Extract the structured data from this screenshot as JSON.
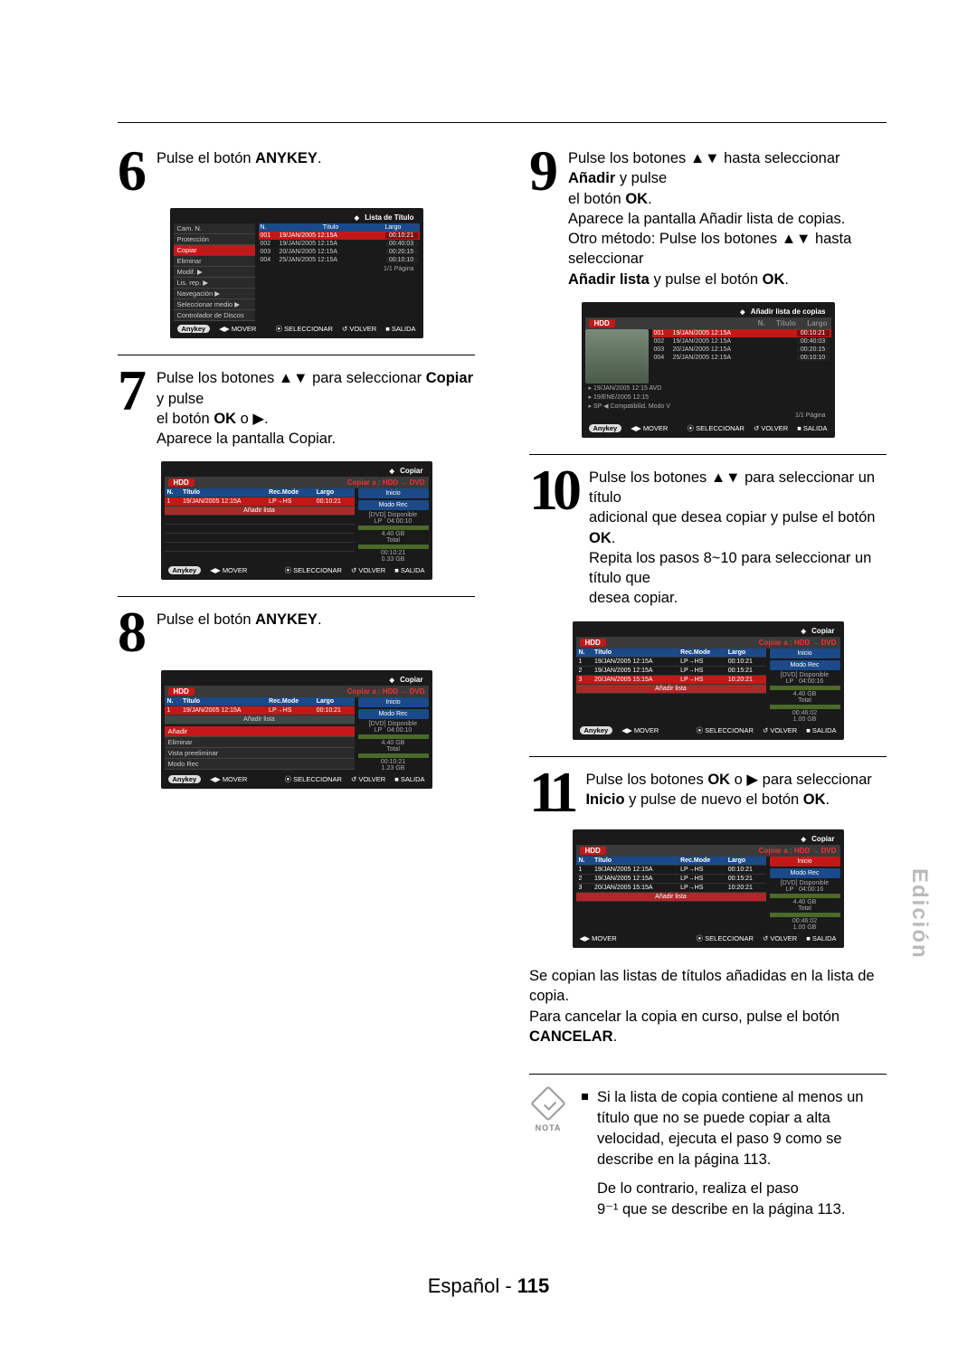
{
  "steps": {
    "s6": {
      "num": "6",
      "html": "Pulse el botón <b>ANYKEY</b>."
    },
    "s7": {
      "num": "7",
      "line1": "Pulse los botones ▲▼ para seleccionar <b>Copiar</b> y pulse",
      "line2": "el botón <b>OK</b> o ▶.",
      "line3": "Aparece la pantalla Copiar."
    },
    "s8": {
      "num": "8",
      "html": "Pulse el botón <b>ANYKEY</b>."
    },
    "s9": {
      "num": "9",
      "line1": "Pulse los botones ▲▼ hasta seleccionar <b>Añadir</b> y pulse",
      "line2": "el botón <b>OK</b>.",
      "line3": "Aparece la pantalla Añadir lista de copias.",
      "line4": "Otro método: Pulse los botones ▲▼ hasta seleccionar",
      "line5": "<b>Añadir lista</b> y pulse el botón <b>OK</b>."
    },
    "s10": {
      "num": "10",
      "line1": "Pulse los botones ▲▼ para seleccionar un título",
      "line2": "adicional que desea copiar y pulse el botón <b>OK</b>.",
      "line3": "Repita los pasos 8~10 para seleccionar un título que",
      "line4": "desea copiar."
    },
    "s11": {
      "num": "11",
      "line1": "Pulse los botones <b>OK</b> o ▶ para seleccionar",
      "line2": "<b>Inicio</b> y pulse de nuevo el botón <b>OK</b>."
    },
    "post11": {
      "line1": "Se copian las listas de títulos añadidas en la lista de copia.",
      "line2": "Para cancelar la copia en curso, pulse el botón",
      "line3": "<b>CANCELAR</b>."
    }
  },
  "note": {
    "label": "NOTA",
    "b1": "Si la lista de copia contiene al menos un título que no se puede copiar a alta velocidad, ejecuta el paso 9 como se describe en la página 113.",
    "b2a": "De lo contrario, realiza el paso",
    "b2b": "9⁻¹ que se describe en la página 113."
  },
  "footer": {
    "lang": "Español",
    "dash": " - ",
    "page": "115"
  },
  "side_tab": "Edición",
  "ui": {
    "anykey": "Anykey",
    "mover": "MOVER",
    "seleccionar": "SELECCIONAR",
    "volver": "VOLVER",
    "salida": "SALIDA",
    "pagina": "1/1 Página",
    "lista_titulo": "Lista de Título",
    "copiar": "Copiar",
    "anadir_lista_copias": "Añadir lista de copias",
    "hdd": "HDD",
    "copiar_a": "Copiar a : HDD → DVD",
    "n": "N.",
    "titulo": "Título",
    "recmode": "Rec.Mode",
    "largo": "Largo",
    "inicio": "Inicio",
    "modo_rec": "Modo Rec",
    "dvd_disp": "[DVD] Disponible",
    "anadir_lista": "Añadir lista",
    "total": "Total"
  },
  "ss6_sidebar": [
    "Cam. N.",
    "Protección",
    "Copiar",
    "Eliminar",
    "Modif.",
    "Lis. rep.",
    "Navegación",
    "Seleccionar medio",
    "Controlador de Discos"
  ],
  "ss6_list": [
    {
      "n": "001",
      "t": "19/JAN/2005 12:15A",
      "l": "00:10:21"
    },
    {
      "n": "002",
      "t": "19/JAN/2005 12:15A",
      "l": "00:40:03"
    },
    {
      "n": "003",
      "t": "20/JAN/2005 12:15A",
      "l": "00:20:15"
    },
    {
      "n": "004",
      "t": "25/JAN/2005 12:15A",
      "l": "00:10:10"
    }
  ],
  "ss7_row": {
    "n": "1",
    "t": "19/JAN/2005 12:15A",
    "m": "LP→HS",
    "l": "00:10:21"
  },
  "ss7_right": {
    "lp": "LP",
    "time": "04:00:10",
    "gb": "4.40 GB",
    "t2": "00:10:21",
    "gb2": "0.33 GB"
  },
  "ss8_sidebar": [
    "Añadir",
    "Eliminar",
    "Vista preeliminar",
    "Modo Rec"
  ],
  "ss8_right": {
    "lp": "LP",
    "time": "04:00:10",
    "gb": "4.40 GB",
    "t2": "00:10:21",
    "gb2": "1.23 GB"
  },
  "ss9_extra": [
    "19/JAN/2005 12:15 AVD",
    "19/ENE/2005 12:15",
    "SP ◀ Compatibilid. Modo V"
  ],
  "ss10_rows": [
    {
      "n": "1",
      "t": "19/JAN/2005 12:15A",
      "m": "LP→HS",
      "l": "00:10:21"
    },
    {
      "n": "2",
      "t": "19/JAN/2005 12:15A",
      "m": "LP→HS",
      "l": "00:15:21"
    },
    {
      "n": "3",
      "t": "20/JAN/2005 15:15A",
      "m": "LP→HS",
      "l": "10:20:21"
    }
  ],
  "ss10_right": {
    "lp": "LP",
    "time": "04:00:16",
    "gb": "4.40 GB",
    "t2": "00:46:02",
    "gb2": "1.00 GB"
  },
  "ss11_right": {
    "lp": "LP",
    "time": "04:00:16",
    "gb": "4.40 GB",
    "t2": "00:46:02",
    "gb2": "1.00 GB"
  }
}
